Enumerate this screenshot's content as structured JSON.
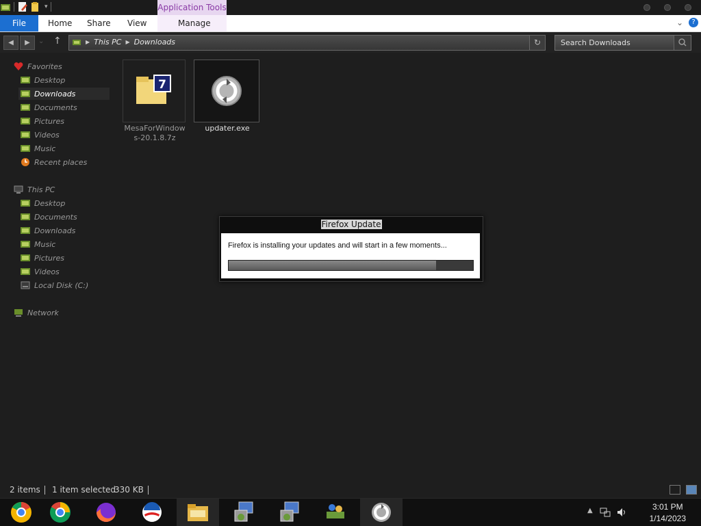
{
  "window": {
    "contextual_tab_label": "Application Tools"
  },
  "ribbon": {
    "tabs": [
      "File",
      "Home",
      "Share",
      "View",
      "Manage"
    ],
    "help": "?"
  },
  "address": {
    "breadcrumb": [
      "This PC",
      "Downloads"
    ]
  },
  "search": {
    "placeholder": "Search Downloads"
  },
  "sidebar": {
    "favorites_label": "Favorites",
    "favorites": [
      "Desktop",
      "Downloads",
      "Documents",
      "Pictures",
      "Videos",
      "Music",
      "Recent places"
    ],
    "thispc_label": "This PC",
    "thispc": [
      "Desktop",
      "Documents",
      "Downloads",
      "Music",
      "Pictures",
      "Videos",
      "Local Disk (C:)"
    ],
    "network_label": "Network",
    "selected": "Downloads"
  },
  "files": [
    {
      "name_line1": "MesaForWindow",
      "name_line2": "s-20.1.8.7z",
      "icon": "7zip-archive-icon"
    },
    {
      "name_line1": "updater.exe",
      "icon": "firefox-updater-icon",
      "selected": true
    }
  ],
  "dialog": {
    "title": "Firefox Update",
    "message": "Firefox is installing your updates and will start in a few moments...",
    "progress": 0.85
  },
  "status": {
    "item_count": "2 items",
    "selection": "1 item selected",
    "size": "330 KB"
  },
  "taskbar": {
    "apps": [
      "chrome-canary-icon",
      "chrome-icon",
      "firefox-icon",
      "obama-logo-icon",
      "file-explorer-icon",
      "installer-icon",
      "installer-icon",
      "network-users-icon",
      "updater-icon"
    ],
    "time": "3:01 PM",
    "date": "1/14/2023"
  },
  "colors": {
    "accent": "#1c6fd1",
    "context_tab": "#e7d6f0",
    "background": "#1e1e1e"
  }
}
